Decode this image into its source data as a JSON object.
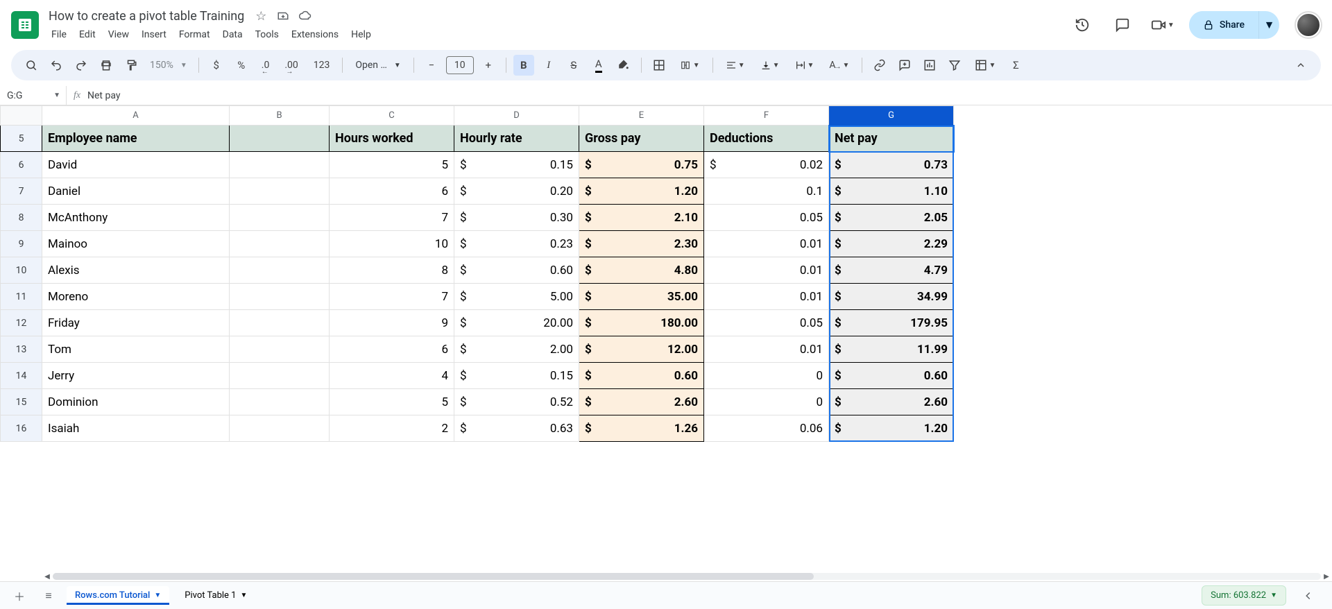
{
  "doc": {
    "title": "How to create a pivot table Training"
  },
  "menus": [
    "File",
    "Edit",
    "View",
    "Insert",
    "Format",
    "Data",
    "Tools",
    "Extensions",
    "Help"
  ],
  "toolbar": {
    "zoom": "150%",
    "currency": "$",
    "percent": "%",
    "dec_dec": ".0",
    "dec_inc": ".00",
    "numfmt": "123",
    "font": "Open …",
    "size": "10",
    "minus": "−",
    "plus": "+"
  },
  "share_label": "Share",
  "namebox": "G:G",
  "fx": "Net pay",
  "columns": [
    "A",
    "B",
    "C",
    "D",
    "E",
    "F",
    "G"
  ],
  "headerRow": {
    "rownum": "5",
    "A": "Employee name",
    "B": "",
    "C": "Hours worked",
    "D": "Hourly rate",
    "E": "Gross pay",
    "F": "Deductions",
    "G": "Net pay"
  },
  "rows": [
    {
      "n": "6",
      "A": "David",
      "C": "5",
      "D": "0.15",
      "E": "0.75",
      "F_pref": "$",
      "F": "0.02",
      "G": "0.73"
    },
    {
      "n": "7",
      "A": "Daniel",
      "C": "6",
      "D": "0.20",
      "E": "1.20",
      "F_pref": "",
      "F": "0.1",
      "G": "1.10"
    },
    {
      "n": "8",
      "A": "McAnthony",
      "C": "7",
      "D": "0.30",
      "E": "2.10",
      "F_pref": "",
      "F": "0.05",
      "G": "2.05"
    },
    {
      "n": "9",
      "A": "Mainoo",
      "C": "10",
      "D": "0.23",
      "E": "2.30",
      "F_pref": "",
      "F": "0.01",
      "G": "2.29"
    },
    {
      "n": "10",
      "A": "Alexis",
      "C": "8",
      "D": "0.60",
      "E": "4.80",
      "F_pref": "",
      "F": "0.01",
      "G": "4.79"
    },
    {
      "n": "11",
      "A": "Moreno",
      "C": "7",
      "D": "5.00",
      "E": "35.00",
      "F_pref": "",
      "F": "0.01",
      "G": "34.99"
    },
    {
      "n": "12",
      "A": "Friday",
      "C": "9",
      "D": "20.00",
      "E": "180.00",
      "F_pref": "",
      "F": "0.05",
      "G": "179.95"
    },
    {
      "n": "13",
      "A": "Tom",
      "C": "6",
      "D": "2.00",
      "E": "12.00",
      "F_pref": "",
      "F": "0.01",
      "G": "11.99"
    },
    {
      "n": "14",
      "A": "Jerry",
      "C": "4",
      "D": "0.15",
      "E": "0.60",
      "F_pref": "",
      "F": "0",
      "G": "0.60"
    },
    {
      "n": "15",
      "A": "Dominion",
      "C": "5",
      "D": "0.52",
      "E": "2.60",
      "F_pref": "",
      "F": "0",
      "G": "2.60"
    },
    {
      "n": "16",
      "A": "Isaiah",
      "C": "2",
      "D": "0.63",
      "E": "1.26",
      "F_pref": "",
      "F": "0.06",
      "G": "1.20"
    }
  ],
  "tabs": {
    "active": "Rows.com Tutorial",
    "other": "Pivot Table 1"
  },
  "sum": "Sum: 603.822"
}
